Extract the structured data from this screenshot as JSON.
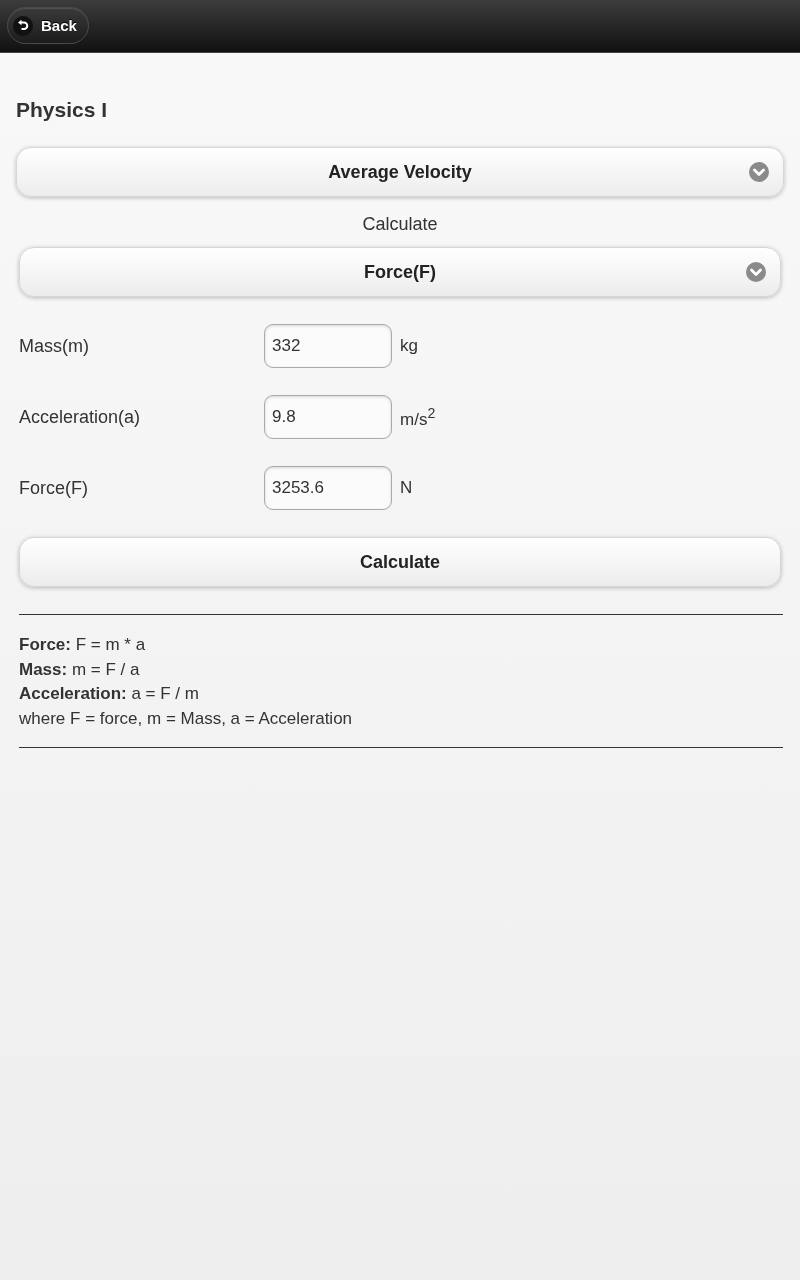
{
  "header": {
    "back_button": "Back"
  },
  "title": "Physics I",
  "topic_select": {
    "value": "Average Velocity"
  },
  "calculate_label": "Calculate",
  "target_select": {
    "value": "Force(F)"
  },
  "fields": [
    {
      "label": "Mass(m)",
      "value": "332",
      "unit": "kg"
    },
    {
      "label": "Acceleration(a)",
      "value": "9.8",
      "unit": "m/s$^{2}$"
    },
    {
      "label": "Force(F)",
      "value": "3253.6",
      "unit": "N"
    }
  ],
  "calculate_button": "Calculate",
  "formulas": [
    "**Force:** F = m * a",
    "**Mass:** m = F / a",
    "**Acceleration:** a = F / m",
    "where F = force, m = Mass, a = Acceleration"
  ]
}
